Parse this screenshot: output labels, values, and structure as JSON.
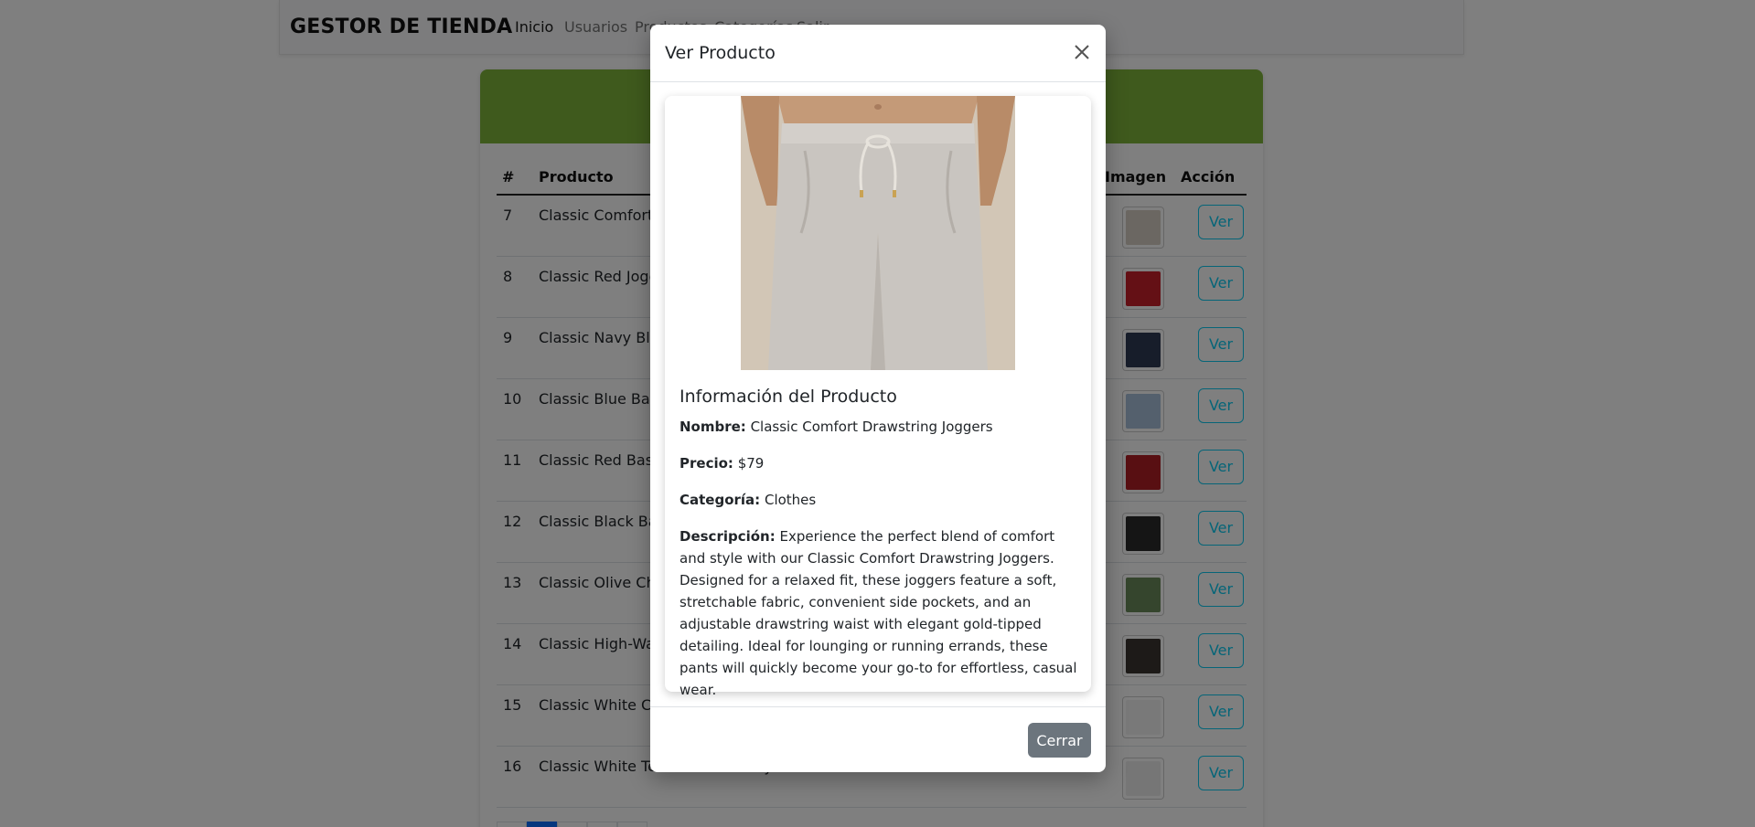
{
  "navbar": {
    "brand": "GESTOR DE TIENDA",
    "links": [
      "Inicio",
      "Usuarios",
      "Productos",
      "Categorías",
      "Salir"
    ]
  },
  "table": {
    "headers": {
      "id": "#",
      "product": "Producto",
      "image": "Imagen",
      "action": "Acción"
    },
    "action_label": "Ver",
    "rows": [
      {
        "id": "7",
        "name": "Classic Comfort Drawstring Joggers",
        "thumb_color": "#d7cfc4"
      },
      {
        "id": "8",
        "name": "Classic Red Jogger Sweatpants",
        "thumb_color": "#c8202a"
      },
      {
        "id": "9",
        "name": "Classic Navy Blue Baseball Cap",
        "thumb_color": "#2f3a55"
      },
      {
        "id": "10",
        "name": "Classic Blue Baseball Cap",
        "thumb_color": "#a9c1db"
      },
      {
        "id": "11",
        "name": "Classic Red Baseball Cap",
        "thumb_color": "#b01e25"
      },
      {
        "id": "12",
        "name": "Classic Black Baseball Cap",
        "thumb_color": "#2a2a2a"
      },
      {
        "id": "13",
        "name": "Classic Olive Chino Shorts",
        "thumb_color": "#6b8a5a"
      },
      {
        "id": "14",
        "name": "Classic High-Waisted Athletic Shorts",
        "thumb_color": "#3a3530"
      },
      {
        "id": "15",
        "name": "Classic White Crew Neck T-Shirt",
        "thumb_color": "#f2f2f2"
      },
      {
        "id": "16",
        "name": "Classic White Tee - Timeless Style",
        "thumb_color": "#ededed"
      }
    ]
  },
  "modal": {
    "title": "Ver Producto",
    "section_title": "Información del Producto",
    "nombre_label": "Nombre:",
    "nombre_value": "Classic Comfort Drawstring Joggers",
    "precio_label": "Precio:",
    "precio_value": "$79",
    "categoria_label": "Categoría:",
    "categoria_value": "Clothes",
    "descripcion_label": "Descripción:",
    "descripcion_value": "Experience the perfect blend of comfort and style with our Classic Comfort Drawstring Joggers. Designed for a relaxed fit, these joggers feature a soft, stretchable fabric, convenient side pockets, and an adjustable drawstring waist with elegant gold-tipped detailing. Ideal for lounging or running errands, these pants will quickly become your go-to for effortless, casual wear.",
    "close_label": "Cerrar"
  },
  "colors": {
    "card_header": "#7fb43a",
    "ver_button": "#0dcaf0",
    "cerrar_button": "#6c757d",
    "pagination_active": "#0d6efd"
  }
}
